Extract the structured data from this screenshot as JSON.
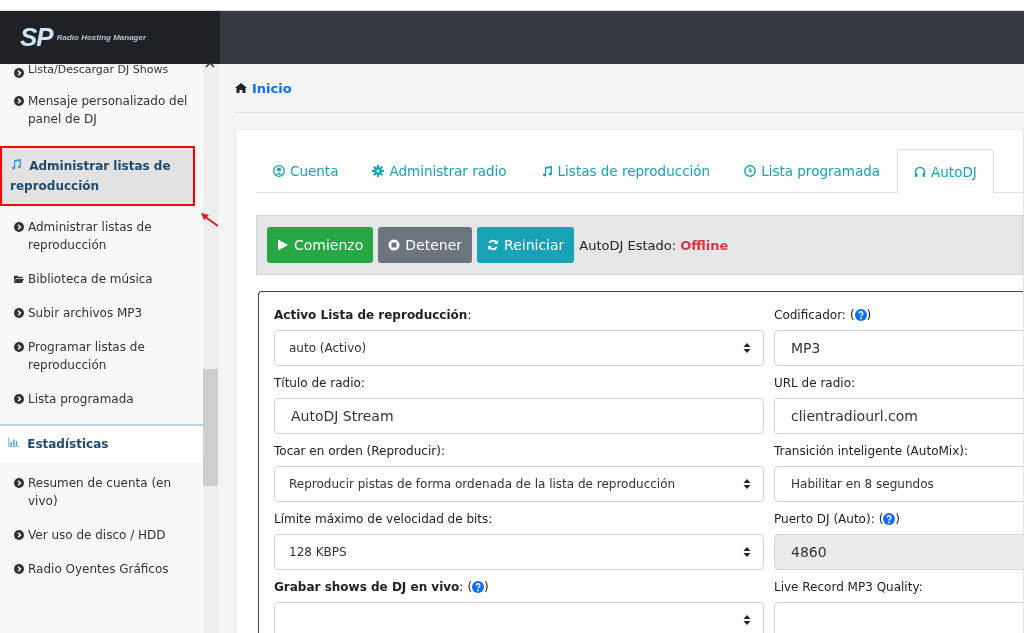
{
  "header": {
    "logo_mark": "SP",
    "logo_text": "Radio Hosting Manager"
  },
  "sidebar": {
    "items": [
      {
        "kind": "item",
        "label": "Lista/Descargar DJ Shows",
        "highlighted": false
      },
      {
        "kind": "item",
        "label": "Mensaje personalizado del panel de DJ",
        "highlighted": false
      },
      {
        "kind": "section",
        "label": "Administrar listas de reproducción",
        "highlighted": true
      },
      {
        "kind": "item",
        "label": "Administrar listas de reproducción",
        "highlighted": false
      },
      {
        "kind": "folder",
        "label": "Biblioteca de música",
        "highlighted": false
      },
      {
        "kind": "item",
        "label": "Subir archivos MP3",
        "highlighted": false
      },
      {
        "kind": "item",
        "label": "Programar listas de reproducción",
        "highlighted": false
      },
      {
        "kind": "item",
        "label": "Lista programada",
        "highlighted": false
      },
      {
        "kind": "section",
        "label": "Estadísticas",
        "highlighted": false
      },
      {
        "kind": "item",
        "label": "Resumen de cuenta (en vivo)",
        "highlighted": false
      },
      {
        "kind": "item",
        "label": "Ver uso de disco / HDD",
        "highlighted": false
      },
      {
        "kind": "item",
        "label": "Radio Oyentes Gráficos",
        "highlighted": false
      }
    ]
  },
  "breadcrumb": "Inicio",
  "tabs": [
    {
      "label": "Cuenta",
      "selected": false
    },
    {
      "label": "Administrar radio",
      "selected": false
    },
    {
      "label": "Listas de reproducción",
      "selected": false
    },
    {
      "label": "Lista programada",
      "selected": false
    },
    {
      "label": "AutoDJ",
      "selected": true
    }
  ],
  "toolbar": {
    "buttons": [
      {
        "kind": "start",
        "label": "Comienzo"
      },
      {
        "kind": "stop",
        "label": "Detener"
      },
      {
        "kind": "restart",
        "label": "Reiniciar"
      }
    ],
    "status_label": "AutoDJ Estado:",
    "status_value": "Offline"
  },
  "form": {
    "fields": [
      {
        "label": "**Activo Lista de reproducción**:",
        "kind": "select",
        "value": "auto (Activo)",
        "disabled": false
      },
      {
        "label": "Codificador:",
        "help_parens": [
          "(",
          ")"
        ],
        "kind": "text",
        "value": "MP3",
        "disabled": false
      },
      {
        "label": "Título de radio:",
        "kind": "text",
        "value": "AutoDJ Stream",
        "disabled": false
      },
      {
        "label": "URL de radio:",
        "kind": "text",
        "value": "clientradiourl.com",
        "disabled": false
      },
      {
        "label": "Tocar en orden (Reproducir):",
        "kind": "select",
        "value": "Reproducir pistas de forma ordenada de la lista de reproducción",
        "disabled": false
      },
      {
        "label": "Transición inteligente (AutoMix):",
        "kind": "text",
        "value": "Habilitar en 8 segundos",
        "disabled": false
      },
      {
        "label": "Límite máximo de velocidad de bits:",
        "kind": "select",
        "value": "128 KBPS",
        "disabled": false
      },
      {
        "label": "Puerto DJ (Auto):",
        "help_parens": [
          "(",
          ")"
        ],
        "kind": "text",
        "value": "4860",
        "disabled": true
      },
      {
        "label": "**Grabar shows de DJ en vivo**:",
        "help_parens": [
          "(",
          ")"
        ],
        "kind": "select",
        "disabled": false
      },
      {
        "label": "Live Record MP3 Quality:",
        "kind": "text",
        "disabled": false
      }
    ]
  }
}
